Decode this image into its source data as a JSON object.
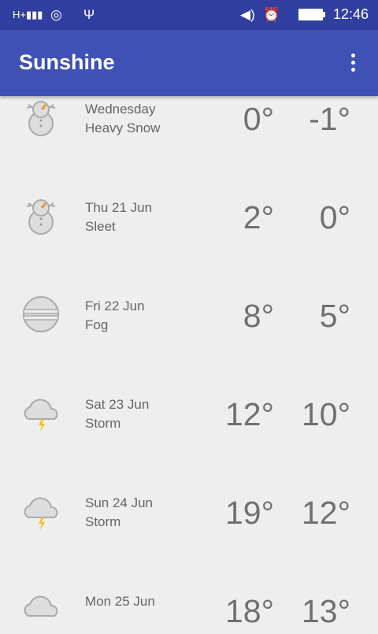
{
  "status_bar": {
    "time": "12:46",
    "network": "H+",
    "icons": [
      "signal-icon",
      "hotspot-icon",
      "usb-icon",
      "volume-icon",
      "alarm-icon",
      "battery-icon"
    ]
  },
  "app_bar": {
    "title": "Sunshine",
    "menu_icon": "overflow-menu-icon"
  },
  "forecast": [
    {
      "day": "Wednesday",
      "desc": "Heavy Snow",
      "high": "0°",
      "low": "-1°",
      "icon": "snow"
    },
    {
      "day": "Thu 21 Jun",
      "desc": "Sleet",
      "high": "2°",
      "low": "0°",
      "icon": "snow"
    },
    {
      "day": "Fri 22 Jun",
      "desc": "Fog",
      "high": "8°",
      "low": "5°",
      "icon": "fog"
    },
    {
      "day": "Sat 23 Jun",
      "desc": "Storm",
      "high": "12°",
      "low": "10°",
      "icon": "storm"
    },
    {
      "day": "Sun 24 Jun",
      "desc": "Storm",
      "high": "19°",
      "low": "12°",
      "icon": "storm"
    },
    {
      "day": "Mon 25 Jun",
      "desc": "",
      "high": "18°",
      "low": "13°",
      "icon": "cloud"
    }
  ]
}
